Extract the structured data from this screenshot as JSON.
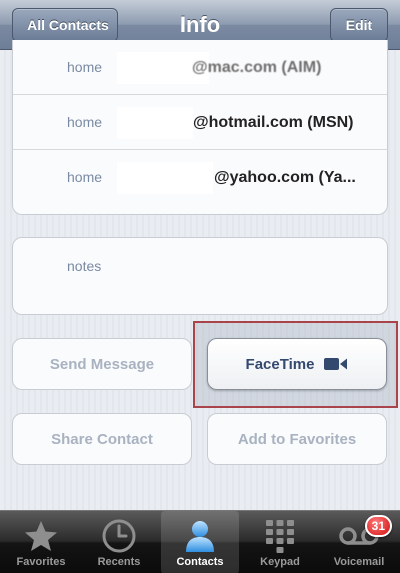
{
  "navbar": {
    "back_label": "All Contacts",
    "title": "Info",
    "edit_label": "Edit"
  },
  "emails": [
    {
      "label": "home",
      "value": "@mac.com (AIM)"
    },
    {
      "label": "home",
      "value": "@hotmail.com (MSN)"
    },
    {
      "label": "home",
      "value": "@yahoo.com (Ya..."
    }
  ],
  "notes": {
    "label": "notes"
  },
  "actions": {
    "send_message": "Send Message",
    "facetime": "FaceTime",
    "share_contact": "Share Contact",
    "add_favorites": "Add to Favorites"
  },
  "tabbar": {
    "items": [
      {
        "label": "Favorites",
        "icon": "star-icon"
      },
      {
        "label": "Recents",
        "icon": "clock-icon"
      },
      {
        "label": "Contacts",
        "icon": "person-icon",
        "active": true
      },
      {
        "label": "Keypad",
        "icon": "keypad-icon"
      },
      {
        "label": "Voicemail",
        "icon": "voicemail-icon",
        "badge": "31"
      }
    ]
  },
  "colors": {
    "accent_red_highlight": "#a9454a",
    "facetime_text": "#34496e",
    "badge_red": "#d10f0f"
  }
}
